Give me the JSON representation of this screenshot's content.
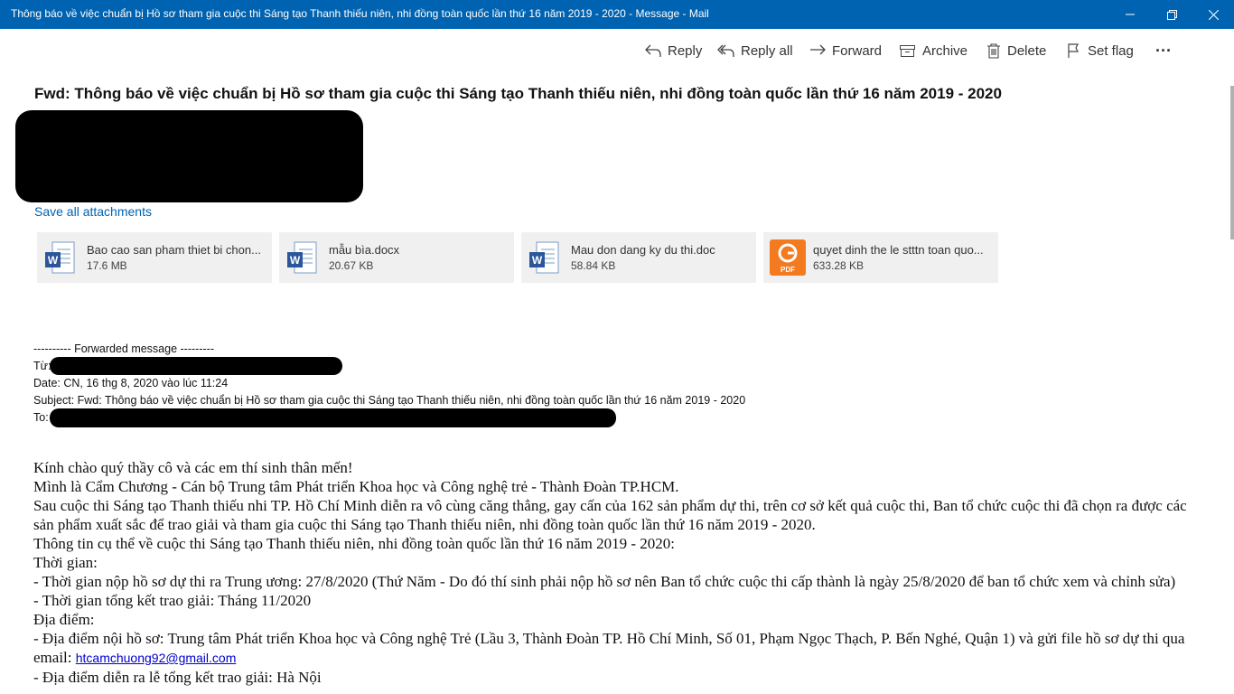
{
  "window": {
    "title": "Thông báo về việc chuẩn bị Hồ sơ tham gia cuộc thi Sáng tạo Thanh thiếu niên, nhi đồng toàn quốc lần thứ 16 năm 2019 - 2020 - Message - Mail"
  },
  "toolbar": {
    "reply": "Reply",
    "reply_all": "Reply all",
    "forward": "Forward",
    "archive": "Archive",
    "delete": "Delete",
    "set_flag": "Set flag",
    "more": "···"
  },
  "message": {
    "subject": "Fwd: Thông báo về việc chuẩn bị Hồ sơ tham gia cuộc thi Sáng tạo Thanh thiếu niên, nhi đồng toàn quốc lần thứ 16 năm 2019 - 2020",
    "save_all": "Save all attachments",
    "attachments": [
      {
        "name": "Bao cao san pham thiet bi chon...",
        "size": "17.6 MB",
        "icon": "word-icon"
      },
      {
        "name": "mẫu bìa.docx",
        "size": "20.67 KB",
        "icon": "word-icon"
      },
      {
        "name": "Mau don dang ky du thi.doc",
        "size": "58.84 KB",
        "icon": "word-icon"
      },
      {
        "name": "quyet dinh the le stttn toan quo...",
        "size": "633.28 KB",
        "icon": "pdf-icon"
      }
    ]
  },
  "forwarded": {
    "header": "---------- Forwarded message ---------",
    "from_label": "Từ:",
    "date": "Date: CN, 16 thg 8, 2020 vào lúc 11:24",
    "subject": "Subject: Fwd: Thông báo về việc chuẩn bị Hồ sơ tham gia cuộc thi Sáng tạo Thanh thiếu niên, nhi đồng toàn quốc lần thứ 16 năm 2019 - 2020",
    "to_label": "To:"
  },
  "body": {
    "l1": "Kính chào quý thầy cô và các em thí sinh thân mến!",
    "l2": "Mình là Cẩm Chương - Cán bộ Trung tâm Phát triển Khoa học và Công nghệ trẻ - Thành Đoàn TP.HCM.",
    "l3": "Sau cuộc thi Sáng tạo Thanh thiếu nhi TP. Hồ Chí Minh diễn ra vô cùng căng thẳng, gay cấn của 162 sản phẩm dự thi, trên cơ sở kết quả cuộc thi, Ban tổ chức cuộc thi đã chọn ra được các sản phẩm xuất sắc để trao giải và tham gia cuộc thi Sáng tạo Thanh thiếu niên, nhi đồng toàn quốc lần thứ 16 năm 2019 - 2020.",
    "l4": "Thông tin cụ thể về cuộc thi Sáng tạo Thanh thiếu niên, nhi đồng toàn quốc lần thứ 16 năm 2019 - 2020:",
    "l5": "Thời gian:",
    "l6": "- Thời gian nộp hồ sơ dự thi ra Trung ương: 27/8/2020 (Thứ Năm - Do đó thí sinh phải nộp hồ sơ nên Ban tổ chức cuộc thi cấp thành là ngày 25/8/2020 để ban tổ chức xem và chỉnh sửa)",
    "l7": "- Thời gian tổng kết trao giải: Tháng 11/2020",
    "l8": "Địa điểm:",
    "l9": "- Địa điểm nội hồ sơ: Trung tâm Phát triển Khoa học và Công nghệ Trẻ (Lầu 3, Thành Đoàn TP. Hồ Chí Minh, Số 01, Phạm Ngọc Thạch, P. Bến Nghé, Quận 1) và gửi file hồ sơ dự thi qua email: ",
    "email": "htcamchuong92@gmail.com",
    "l10": "- Địa điểm diễn ra lễ tổng kết trao giải: Hà Nội"
  },
  "colors": {
    "titlebar": "#0063b1",
    "link": "#0063b1",
    "attachment_bg": "#f0f0f0",
    "pdf_orange": "#f47a20",
    "word_blue": "#2b579a"
  }
}
